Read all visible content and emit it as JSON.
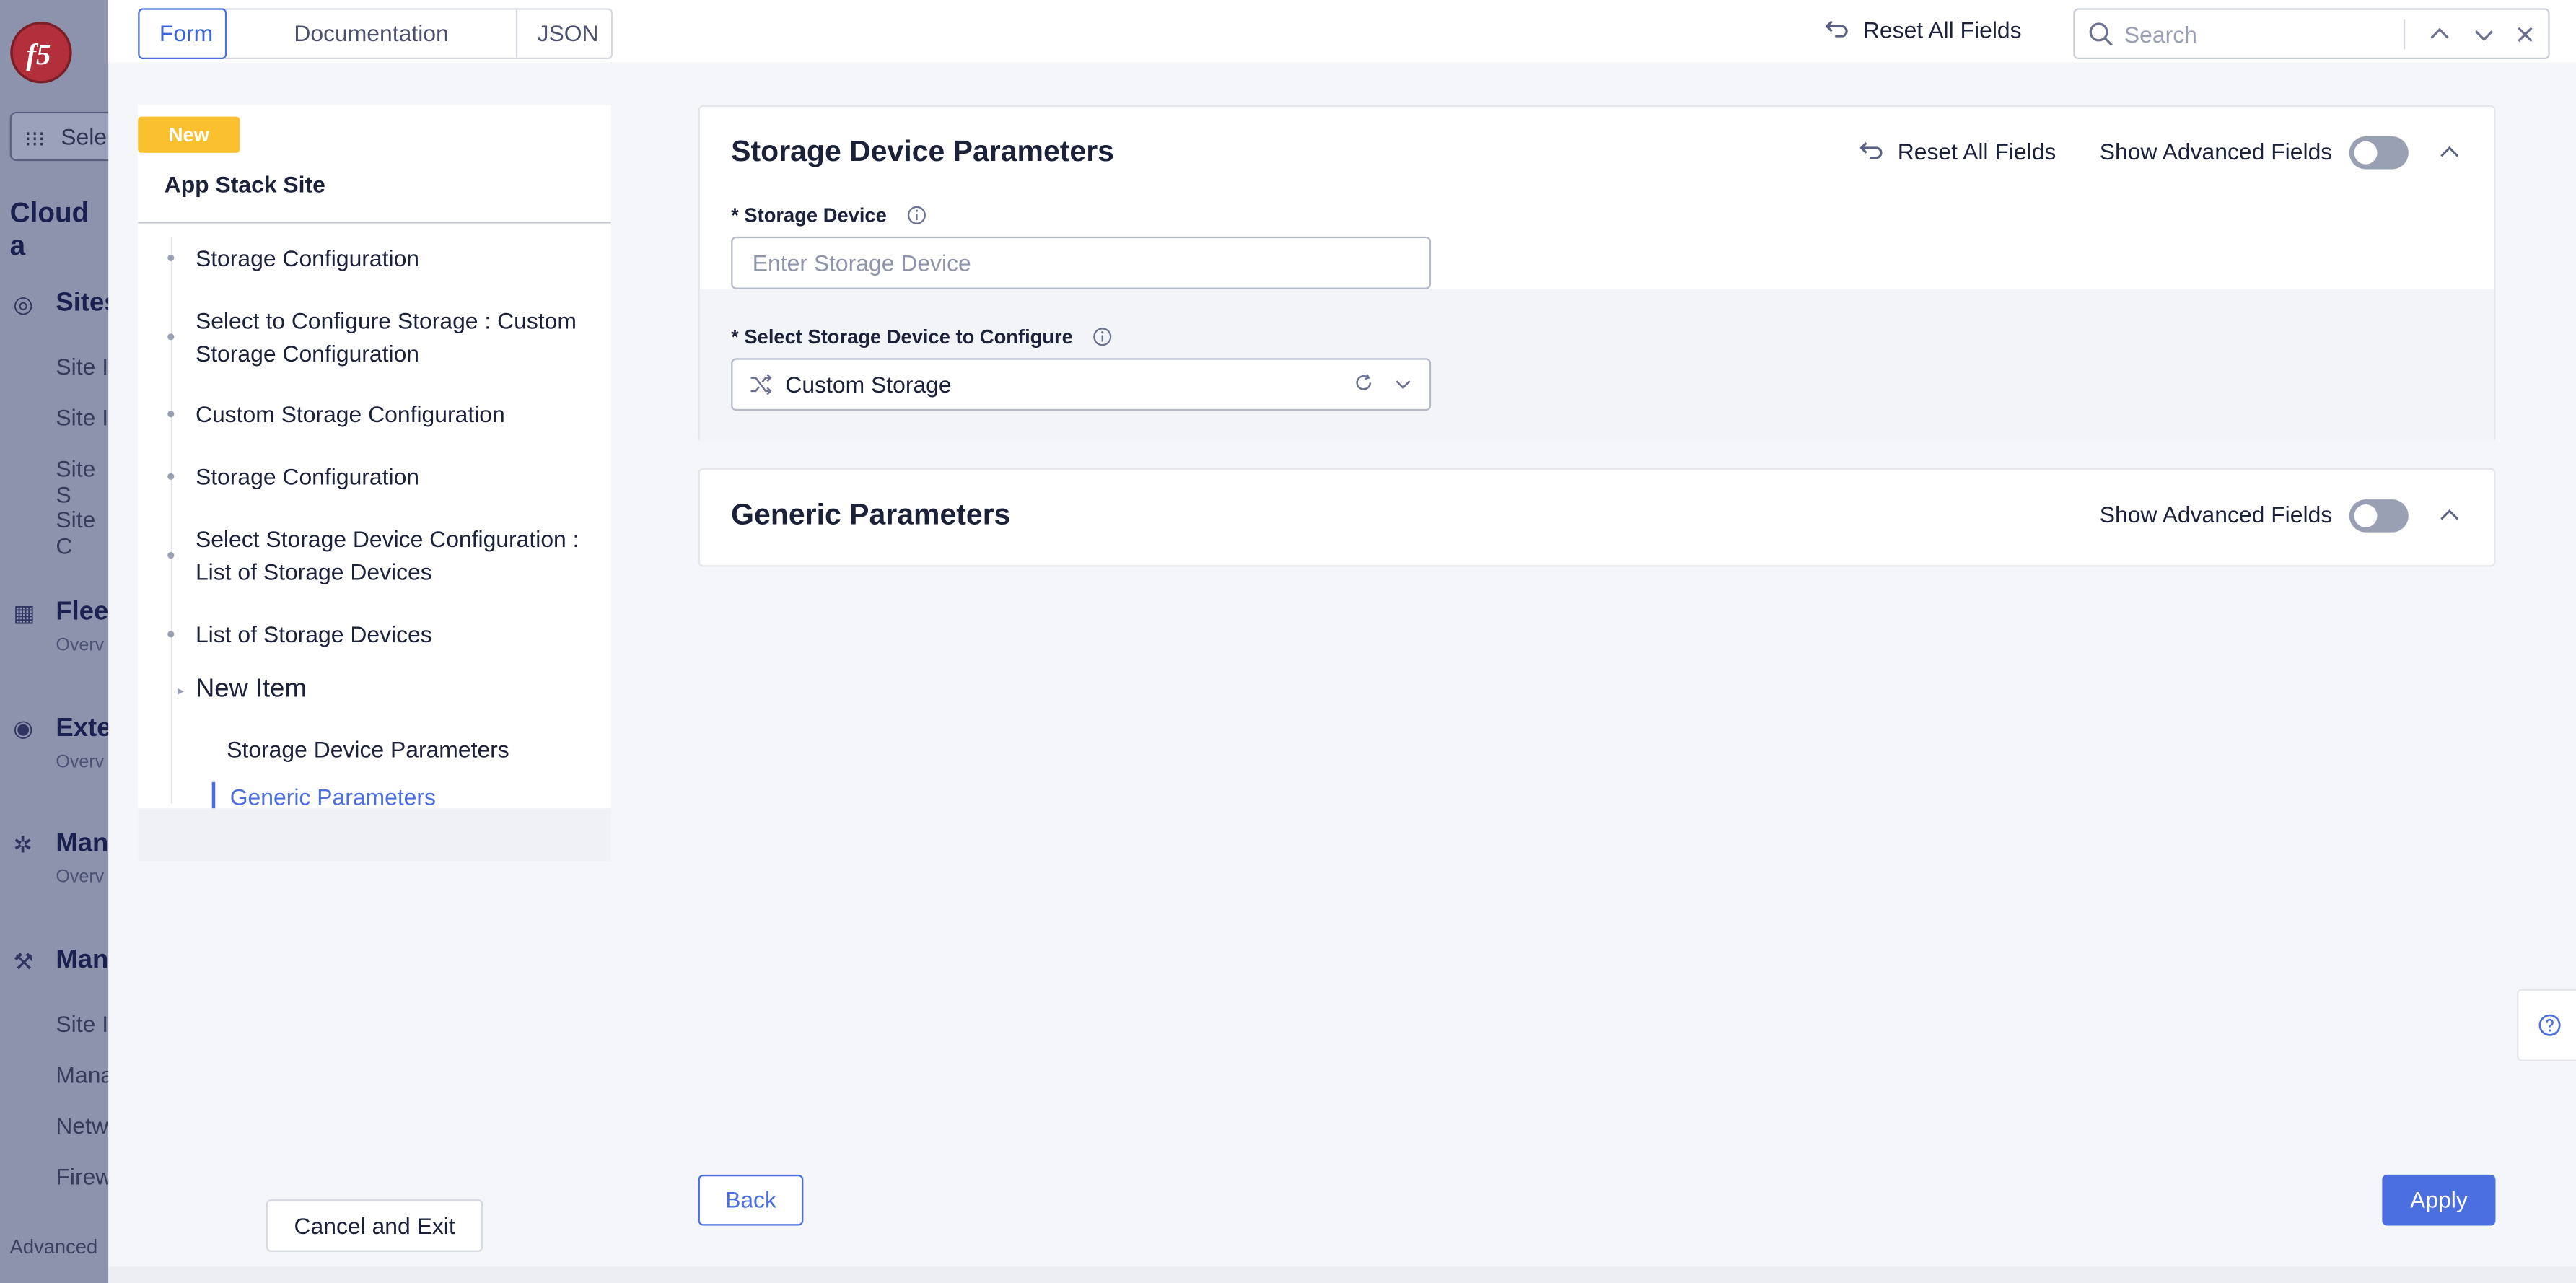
{
  "background_app": {
    "select_label": "Sele",
    "title": "Cloud a",
    "sections": [
      {
        "label": "Sites",
        "items": [
          "Site I",
          "Site I",
          "Site S",
          "Site C"
        ]
      },
      {
        "label": "Fleet",
        "sub": "Overv"
      },
      {
        "label": "Exte",
        "sub": "Overv"
      },
      {
        "label": "Man",
        "sub": "Overv"
      },
      {
        "label": "Man",
        "items": [
          "Site I",
          "Mana",
          "Netw",
          "Firew"
        ]
      }
    ],
    "advanced": "Advanced"
  },
  "topbar": {
    "tabs": [
      {
        "label": "Form",
        "active": true
      },
      {
        "label": "Documentation",
        "active": false
      },
      {
        "label": "JSON",
        "active": false
      }
    ],
    "reset_label": "Reset All Fields",
    "search_placeholder": "Search"
  },
  "nav": {
    "badge": "New",
    "title": "App Stack Site",
    "items": [
      "Storage Configuration",
      "Select to Configure Storage : Custom Storage Configuration",
      "Custom Storage Configuration",
      "Storage Configuration",
      "Select Storage Device Configuration : List of Storage Devices",
      "List of Storage Devices",
      "New Item"
    ],
    "sub_items": [
      "Storage Device Parameters",
      "Generic Parameters"
    ],
    "cancel_label": "Cancel and Exit"
  },
  "card1": {
    "title": "Storage Device Parameters",
    "reset_label": "Reset All Fields",
    "advanced_label": "Show Advanced Fields",
    "advanced_on": false,
    "field1_label": "* Storage Device",
    "field1_placeholder": "Enter Storage Device",
    "field2_label": "* Select Storage Device to Configure",
    "field2_value": "Custom Storage"
  },
  "card2": {
    "title": "Generic Parameters",
    "advanced_label": "Show Advanced Fields",
    "advanced_on": false
  },
  "footer": {
    "back_label": "Back",
    "apply_label": "Apply"
  },
  "colors": {
    "accent": "#4b6fe0",
    "badge": "#fbc02d",
    "overlay": "#8d93ad"
  },
  "icons": [
    "f5-logo-icon",
    "grid-icon",
    "reset-icon",
    "search-icon",
    "chevron-up-icon",
    "chevron-down-icon",
    "close-icon",
    "info-icon",
    "shuffle-icon",
    "refresh-icon",
    "help-icon"
  ]
}
